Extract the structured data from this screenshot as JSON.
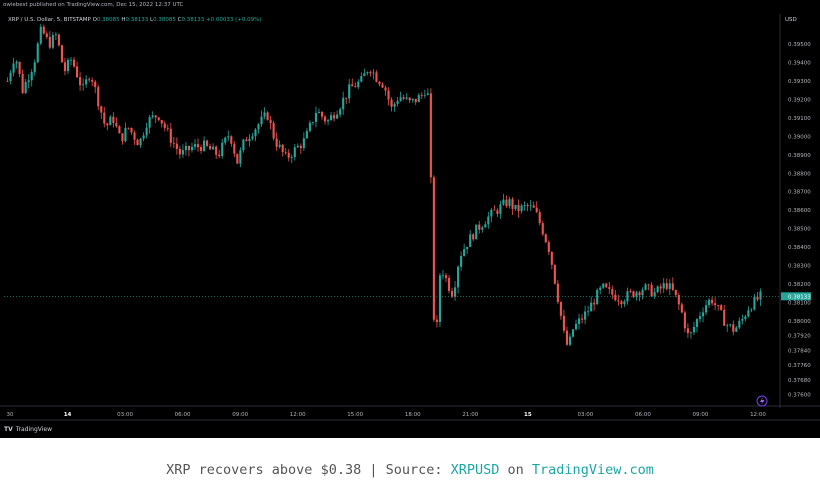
{
  "header": {
    "publisher": "owiebest published on TradingView.com, Dec 15, 2022 12:37 UTC",
    "symbol": "XRP / U.S. Dollar, 5, BITSTAMP",
    "o_label": "O",
    "o_value": "0.38085",
    "h_label": "H",
    "h_value": "0.38133",
    "l_label": "L",
    "l_value": "0.38085",
    "c_label": "C",
    "c_value": "0.38133",
    "change": "+0.00033 (+0.09%)",
    "currency": "USD"
  },
  "footer": {
    "brand": "TradingView",
    "brand_icon": "tradingview-logo-icon"
  },
  "caption": {
    "text": "XRP recovers above $0.38 | Source: ",
    "link1": "XRPUSD",
    "middle": " on ",
    "link2": "TradingView.com"
  },
  "colors": {
    "background": "#000000",
    "up": "#26a69a",
    "down": "#ef5350",
    "grid": "#1a1a1a",
    "text": "#b2b5be",
    "last_price": "#26a69a",
    "caption_link": "#1aa6a6"
  },
  "chart_data": {
    "type": "candlestick",
    "title": "XRP / U.S. Dollar, 5, BITSTAMP",
    "ylabel": "USD",
    "ylim": [
      0.3756,
      0.3962
    ],
    "yticks": [
      "0.39500",
      "0.39400",
      "0.39300",
      "0.39200",
      "0.39100",
      "0.39000",
      "0.38900",
      "0.38800",
      "0.38700",
      "0.38600",
      "0.38500",
      "0.38400",
      "0.38300",
      "0.38200",
      "0.38100",
      "0.38000",
      "0.37920",
      "0.37840",
      "0.37760",
      "0.37680",
      "0.37600"
    ],
    "xticks": [
      "30",
      "14",
      "03:00",
      "06:00",
      "09:00",
      "12:00",
      "15:00",
      "18:00",
      "21:00",
      "15",
      "03:00",
      "06:00",
      "09:00",
      "12:00"
    ],
    "xticks_bold": [
      "14",
      "15"
    ],
    "last_price": 0.38133,
    "last_price_label": "0.38133",
    "grid": false,
    "path": [
      [
        0.0,
        0.393
      ],
      [
        0.01,
        0.3945
      ],
      [
        0.02,
        0.3925
      ],
      [
        0.035,
        0.394
      ],
      [
        0.045,
        0.3958
      ],
      [
        0.055,
        0.395
      ],
      [
        0.065,
        0.3955
      ],
      [
        0.075,
        0.3935
      ],
      [
        0.085,
        0.3942
      ],
      [
        0.1,
        0.3925
      ],
      [
        0.11,
        0.3935
      ],
      [
        0.12,
        0.392
      ],
      [
        0.13,
        0.3905
      ],
      [
        0.14,
        0.391
      ],
      [
        0.15,
        0.3898
      ],
      [
        0.16,
        0.3905
      ],
      [
        0.175,
        0.3896
      ],
      [
        0.185,
        0.3908
      ],
      [
        0.2,
        0.3912
      ],
      [
        0.215,
        0.39
      ],
      [
        0.23,
        0.389
      ],
      [
        0.245,
        0.3894
      ],
      [
        0.26,
        0.3895
      ],
      [
        0.28,
        0.389
      ],
      [
        0.295,
        0.3902
      ],
      [
        0.305,
        0.3886
      ],
      [
        0.315,
        0.3898
      ],
      [
        0.33,
        0.3905
      ],
      [
        0.345,
        0.3912
      ],
      [
        0.355,
        0.3898
      ],
      [
        0.37,
        0.3888
      ],
      [
        0.38,
        0.3892
      ],
      [
        0.395,
        0.3898
      ],
      [
        0.41,
        0.3914
      ],
      [
        0.425,
        0.3908
      ],
      [
        0.44,
        0.3916
      ],
      [
        0.455,
        0.3926
      ],
      [
        0.47,
        0.393
      ],
      [
        0.48,
        0.3938
      ],
      [
        0.49,
        0.3932
      ],
      [
        0.5,
        0.3928
      ],
      [
        0.51,
        0.3915
      ],
      [
        0.52,
        0.3922
      ],
      [
        0.535,
        0.3918
      ],
      [
        0.55,
        0.3922
      ],
      [
        0.555,
        0.3926
      ],
      [
        0.56,
        0.392
      ],
      [
        0.562,
        0.388
      ],
      [
        0.564,
        0.384
      ],
      [
        0.567,
        0.379
      ],
      [
        0.57,
        0.3795
      ],
      [
        0.575,
        0.383
      ],
      [
        0.58,
        0.3825
      ],
      [
        0.59,
        0.3815
      ],
      [
        0.595,
        0.3822
      ],
      [
        0.6,
        0.3835
      ],
      [
        0.61,
        0.3842
      ],
      [
        0.62,
        0.3848
      ],
      [
        0.635,
        0.3855
      ],
      [
        0.65,
        0.386
      ],
      [
        0.665,
        0.3865
      ],
      [
        0.675,
        0.386
      ],
      [
        0.69,
        0.3862
      ],
      [
        0.7,
        0.386
      ],
      [
        0.71,
        0.385
      ],
      [
        0.72,
        0.3838
      ],
      [
        0.73,
        0.3815
      ],
      [
        0.74,
        0.379
      ],
      [
        0.745,
        0.3785
      ],
      [
        0.75,
        0.3795
      ],
      [
        0.76,
        0.38
      ],
      [
        0.77,
        0.3805
      ],
      [
        0.78,
        0.3812
      ],
      [
        0.79,
        0.3818
      ],
      [
        0.8,
        0.3815
      ],
      [
        0.815,
        0.3812
      ],
      [
        0.83,
        0.3815
      ],
      [
        0.845,
        0.3818
      ],
      [
        0.86,
        0.3815
      ],
      [
        0.875,
        0.382
      ],
      [
        0.885,
        0.3815
      ],
      [
        0.895,
        0.3805
      ],
      [
        0.905,
        0.379
      ],
      [
        0.915,
        0.38
      ],
      [
        0.925,
        0.3808
      ],
      [
        0.935,
        0.3812
      ],
      [
        0.945,
        0.3805
      ],
      [
        0.955,
        0.3798
      ],
      [
        0.965,
        0.3795
      ],
      [
        0.975,
        0.38
      ],
      [
        0.985,
        0.3808
      ],
      [
        1.0,
        0.3813
      ]
    ]
  }
}
